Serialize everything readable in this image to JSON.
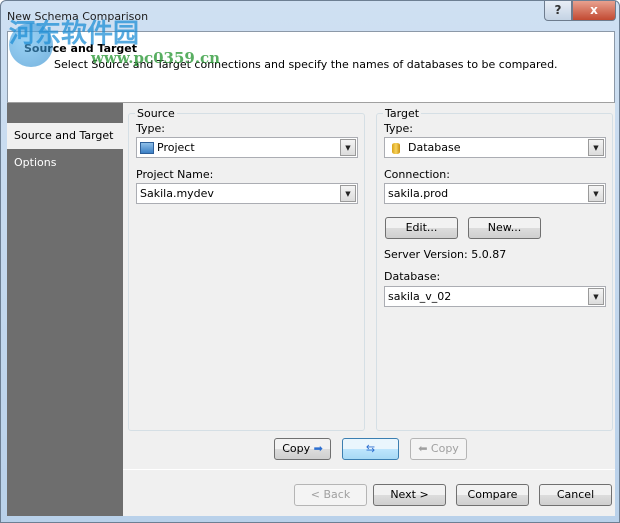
{
  "window": {
    "title": "New Schema Comparison",
    "help": "?",
    "close": "x"
  },
  "watermark": {
    "name": "河东软件园",
    "url": "www.pc0359.cn"
  },
  "header": {
    "title": "Source and Target",
    "description": "Select Source and Target connections and specify the names of databases to be compared."
  },
  "sidebar": {
    "items": [
      {
        "label": "Source and Target",
        "selected": true
      },
      {
        "label": "Options",
        "selected": false
      }
    ]
  },
  "source": {
    "group": "Source",
    "type_label": "Type:",
    "type_value": "Project",
    "name_label": "Project Name:",
    "name_value": "Sakila.mydev"
  },
  "target": {
    "group": "Target",
    "type_label": "Type:",
    "type_value": "Database",
    "connection_label": "Connection:",
    "connection_value": "sakila.prod",
    "edit": "Edit...",
    "new": "New...",
    "server_version": "Server Version: 5.0.87",
    "database_label": "Database:",
    "database_value": "sakila_v_02"
  },
  "copy": {
    "copy_right": "Copy",
    "copy_left": "Copy"
  },
  "footer": {
    "back": "< Back",
    "next": "Next >",
    "compare": "Compare",
    "cancel": "Cancel"
  }
}
